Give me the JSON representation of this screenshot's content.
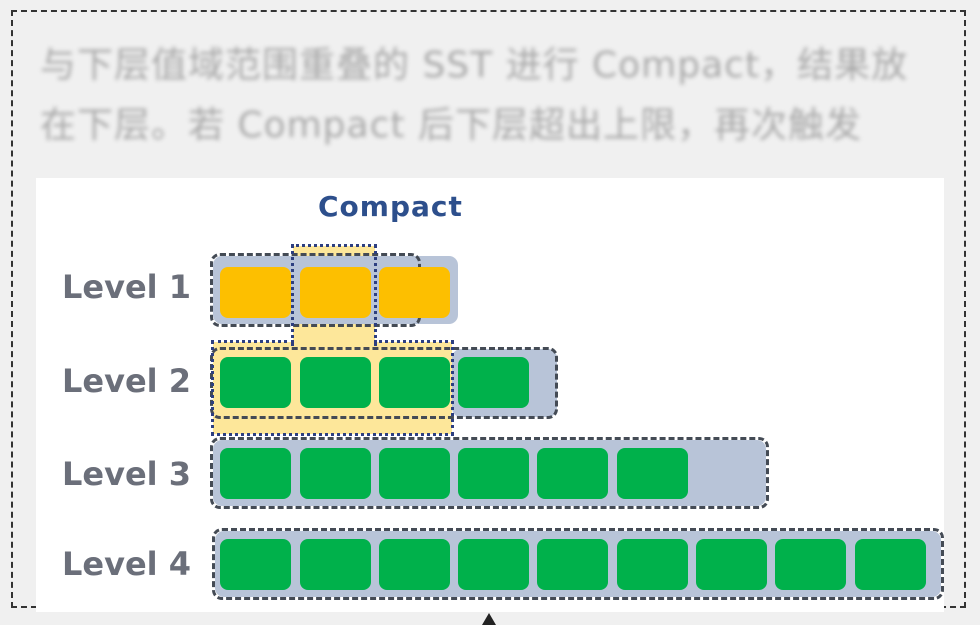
{
  "background_text": {
    "line1": "与下层值域范围重叠的 SST 进行 Compact，结果放",
    "line2": "在下层。若 Compact 后下层超出上限，再次触发"
  },
  "diagram": {
    "title": "Compact",
    "levels": [
      {
        "label": "Level 1",
        "sst_count": 3,
        "color": "#fdbf00"
      },
      {
        "label": "Level 2",
        "sst_count": 4,
        "color": "#00b14b"
      },
      {
        "label": "Level 3",
        "sst_count": 6,
        "color": "#00b14b"
      },
      {
        "label": "Level 4",
        "sst_count": 9,
        "color": "#00b14b"
      }
    ]
  },
  "colors": {
    "sst_level1": "#fdbf00",
    "sst_lower": "#00b14b",
    "track": "#b8c4d8",
    "compaction_highlight": "#fde79a",
    "title": "#2d4f8c"
  }
}
